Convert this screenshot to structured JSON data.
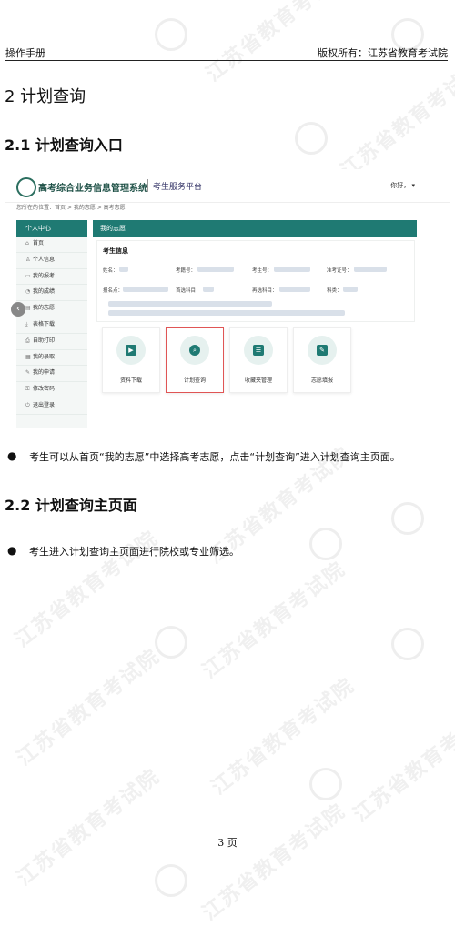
{
  "header": {
    "left": "操作手册",
    "right": "版权所有：江苏省教育考试院"
  },
  "watermark": "江苏省教育考试院",
  "section": {
    "title": "2 计划查询"
  },
  "sub1": {
    "title": "2.1 计划查询入口"
  },
  "screenshot": {
    "app_title": "高考综合业务信息管理系统",
    "app_sub": "考生服务平台",
    "user": "你好，",
    "breadcrumb": "您所在的位置：首页 > 我的志愿 > 高考志愿",
    "side_head": "个人中心",
    "side_items": [
      {
        "icon": "⌂",
        "label": "首页"
      },
      {
        "icon": "♙",
        "label": "个人信息"
      },
      {
        "icon": "▭",
        "label": "我的报考"
      },
      {
        "icon": "◔",
        "label": "我的成绩"
      },
      {
        "icon": "▤",
        "label": "我的志愿"
      },
      {
        "icon": "⤓",
        "label": "表格下载"
      },
      {
        "icon": "⎙",
        "label": "自助打印"
      },
      {
        "icon": "▦",
        "label": "我的录取"
      },
      {
        "icon": "✎",
        "label": "我的申请"
      },
      {
        "icon": "⚿",
        "label": "修改密码"
      },
      {
        "icon": "⏻",
        "label": "退出登录"
      }
    ],
    "main_head": "我的志愿",
    "info_title": "考生信息",
    "fields": [
      "姓名：",
      "考籍号：",
      "考生号：",
      "准考证号：",
      "报名点：",
      "首选科目：",
      "再选科目：",
      "科类："
    ],
    "cards": [
      "资料下载",
      "计划查询",
      "收藏夹管理",
      "志愿填报"
    ]
  },
  "bullet1": "考生可以从首页“我的志愿”中选择高考志愿，点击“计划查询”进入计划查询主页面。",
  "sub2": {
    "title": "2.2 计划查询主页面"
  },
  "bullet2": "考生进入计划查询主页面进行院校或专业筛选。",
  "page": "3 页"
}
